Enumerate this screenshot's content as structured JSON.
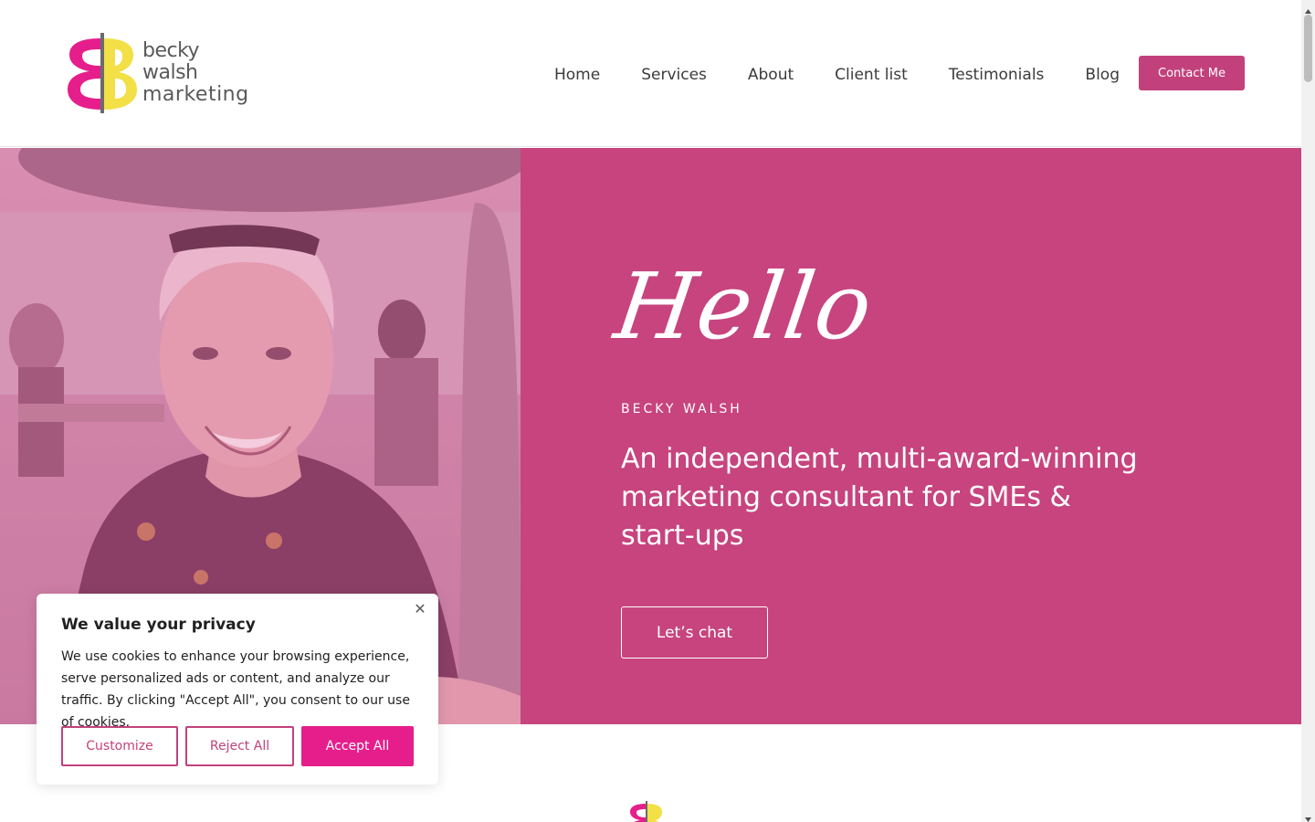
{
  "brand": {
    "line1": "becky walsh",
    "line2": "marketing",
    "colors": {
      "pink": "#e61e8c",
      "yellow": "#f2e046",
      "magenta_panel": "#c7447e"
    }
  },
  "nav": {
    "items": [
      {
        "label": "Home"
      },
      {
        "label": "Services"
      },
      {
        "label": "About"
      },
      {
        "label": "Client list"
      },
      {
        "label": "Testimonials"
      },
      {
        "label": "Blog"
      }
    ],
    "cta": "Contact Me"
  },
  "hero": {
    "script_title": "Hello",
    "kicker": "BECKY WALSH",
    "headline": "An independent, multi-award-winning marketing consultant for SMEs & start-ups",
    "button": "Let’s chat",
    "photo_icon": "portrait-photo"
  },
  "cookie": {
    "title": "We value your privacy",
    "text": "We use cookies to enhance your browsing experience, serve personalized ads or content, and analyze our traffic. By clicking \"Accept All\", you consent to our use of cookies.",
    "customize": "Customize",
    "reject": "Reject All",
    "accept": "Accept All",
    "close_icon": "close-icon"
  }
}
